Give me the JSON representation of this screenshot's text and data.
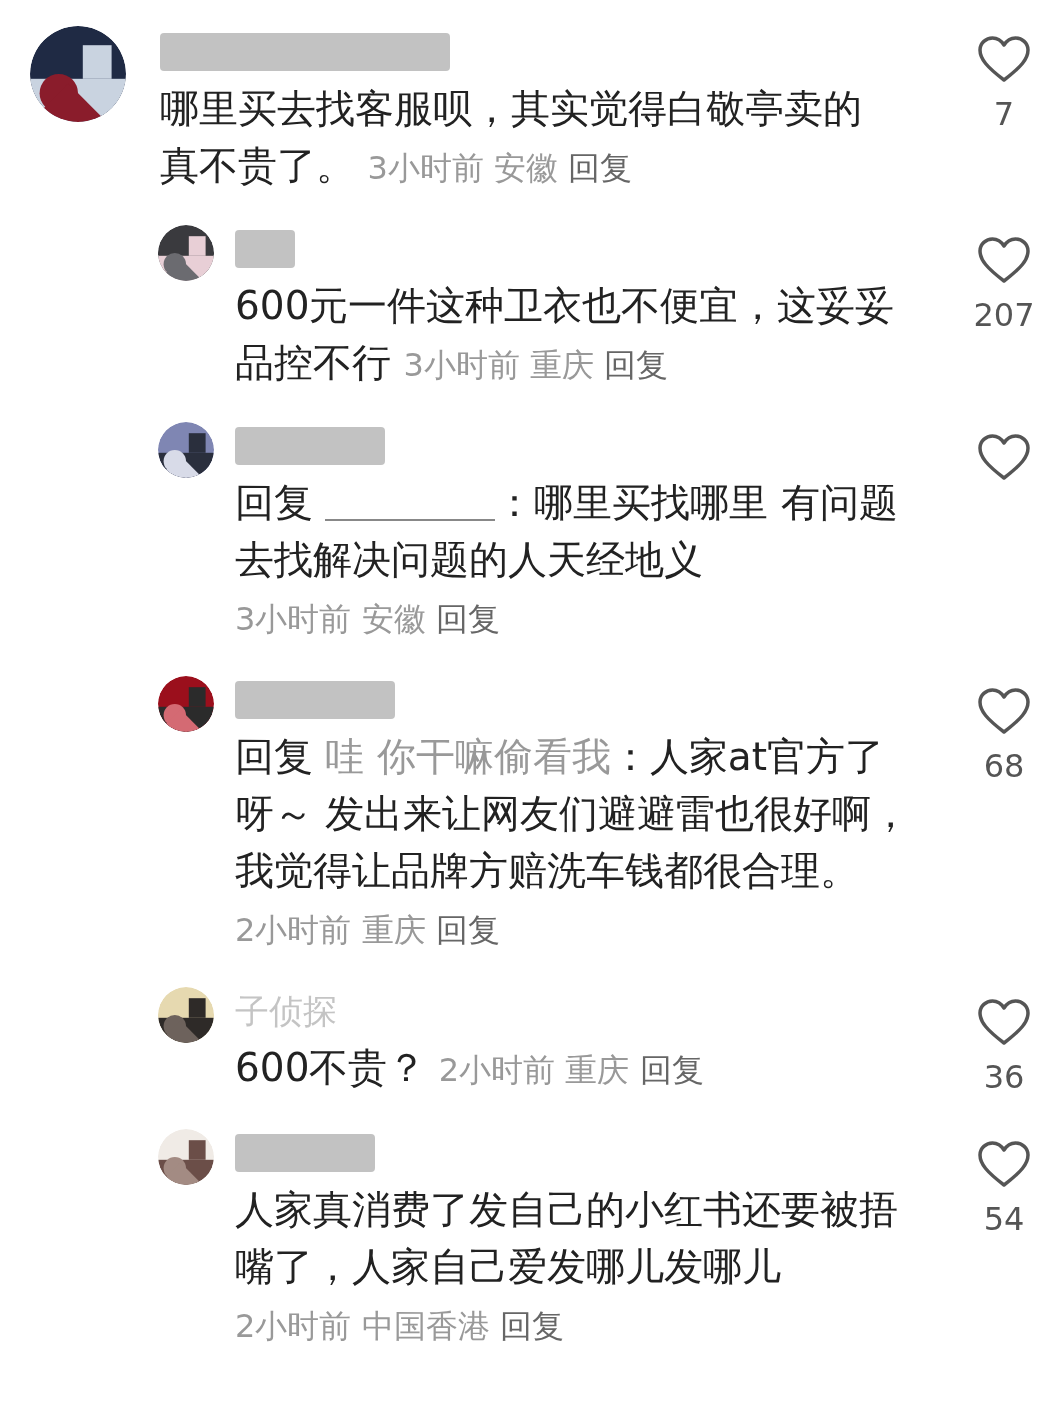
{
  "comment": {
    "username": {
      "kind": "redacted"
    },
    "body": "哪里买去找客服呗，其实觉得白敬亭卖的真不贵了。",
    "time": "3小时前",
    "location": "安徽",
    "reply_label": "回复",
    "likes": "7",
    "replies": [
      {
        "username": {
          "kind": "redacted"
        },
        "body": "600元一件这种卫衣也不便宜，这妥妥品控不行",
        "time": "3小时前",
        "location": "重庆",
        "reply_label": "回复",
        "likes": "207"
      },
      {
        "username": {
          "kind": "redacted"
        },
        "reply_prefix": "回复",
        "mention_redacted": true,
        "body": "：哪里买找哪里 有问题去找解决问题的人天经地义",
        "time": "3小时前",
        "location": "安徽",
        "reply_label": "回复"
      },
      {
        "username": {
          "kind": "redacted"
        },
        "reply_prefix": "回复",
        "mention": "哇 你干嘛偷看我",
        "body": "：人家at官方了呀～ 发出来让网友们避避雷也很好啊，我觉得让品牌方赔洗车钱都很合理。",
        "time": "2小时前",
        "location": "重庆",
        "reply_label": "回复",
        "likes": "68"
      },
      {
        "username": {
          "kind": "text",
          "text": "子侦探"
        },
        "body": "600不贵？",
        "time": "2小时前",
        "location": "重庆",
        "reply_label": "回复",
        "likes": "36"
      },
      {
        "username": {
          "kind": "redacted"
        },
        "body": "人家真消费了发自己的小红书还要被捂嘴了，人家自己爱发哪儿发哪儿",
        "time": "2小时前",
        "location": "中国香港",
        "reply_label": "回复",
        "likes": "54"
      }
    ]
  }
}
